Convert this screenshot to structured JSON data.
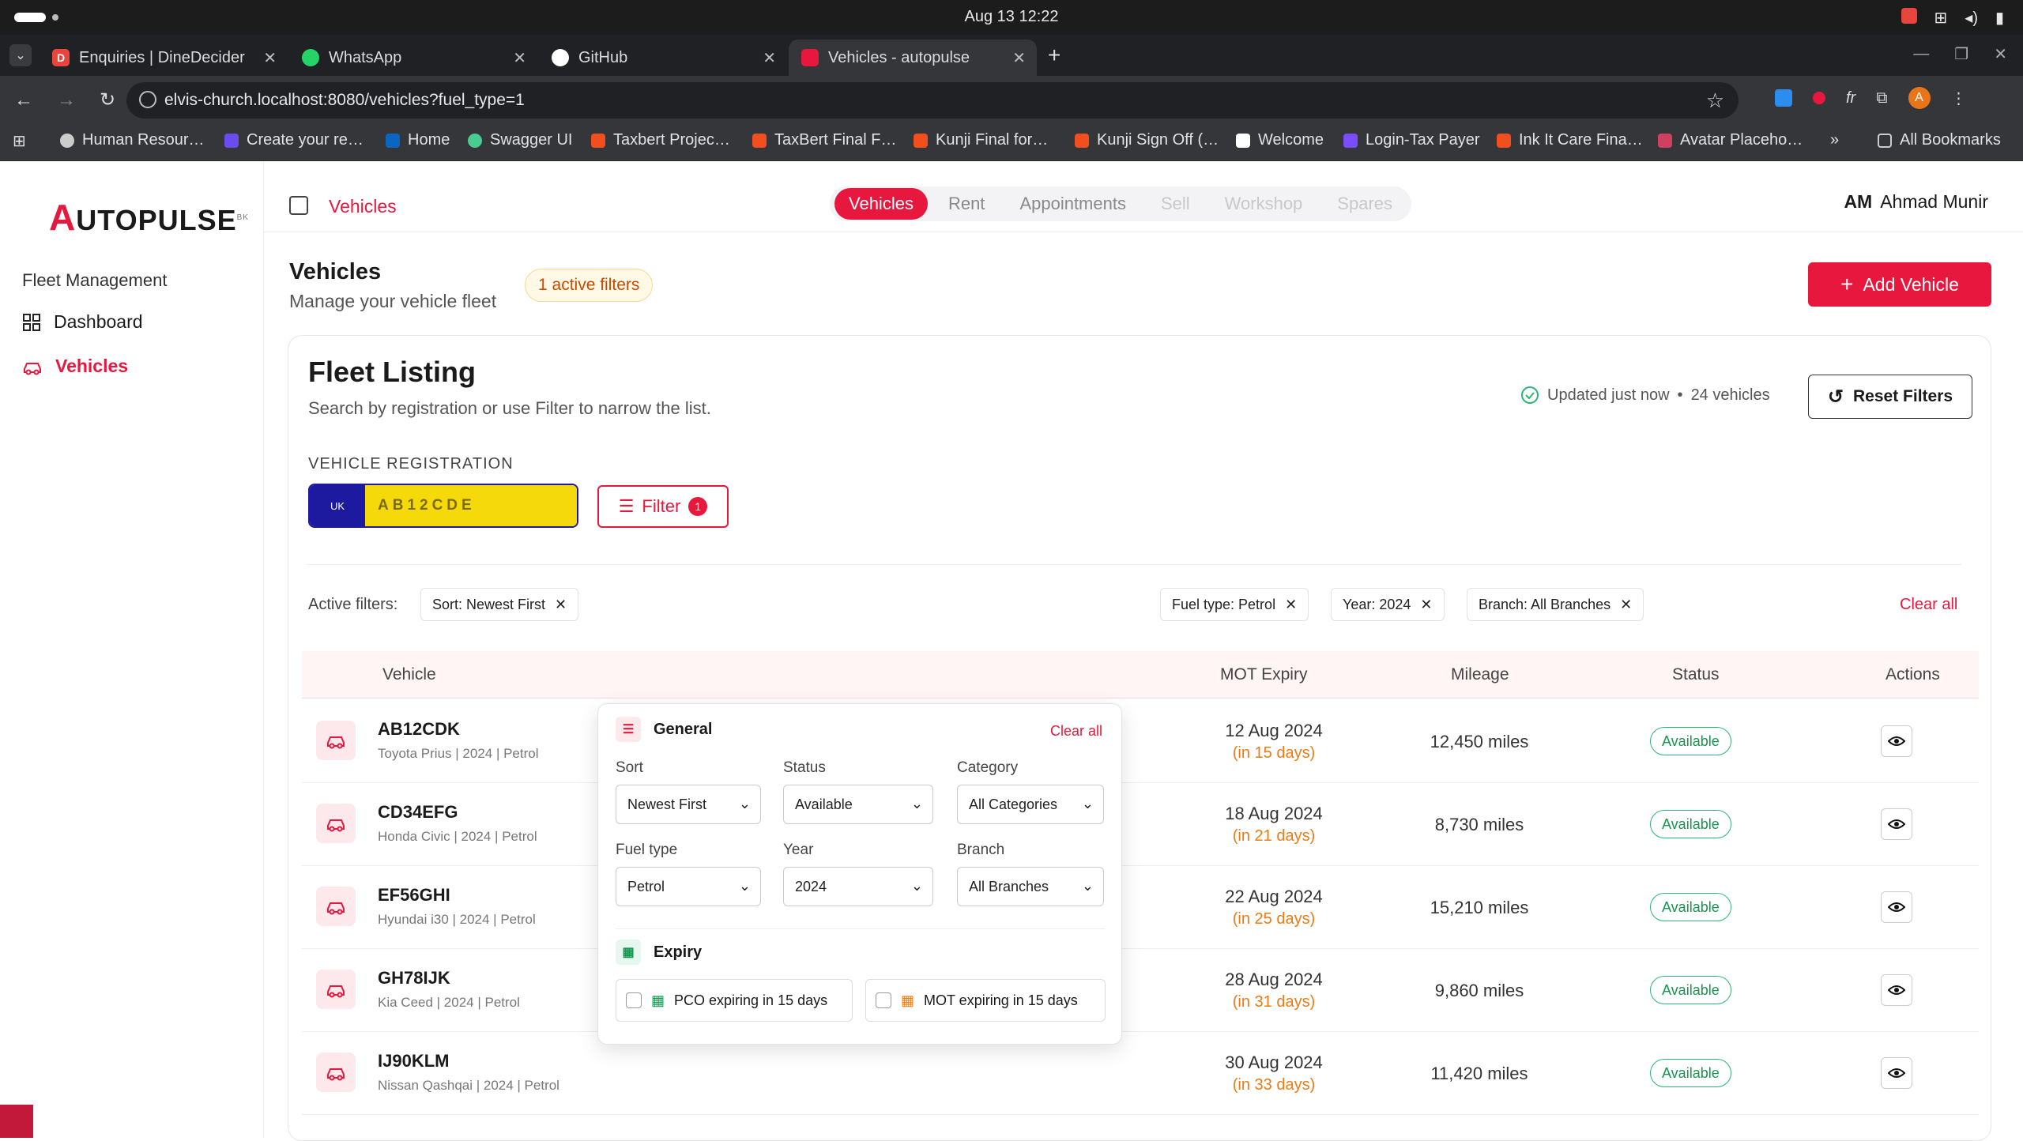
{
  "os": {
    "clock": "Aug 13  12:22"
  },
  "browser": {
    "tabs": [
      {
        "label": "Enquiries | DineDecider",
        "color": "#e8453c",
        "glyph": "D"
      },
      {
        "label": "WhatsApp",
        "color": "#25d366",
        "glyph": ""
      },
      {
        "label": "GitHub",
        "color": "#ffffff",
        "glyph": ""
      },
      {
        "label": "Vehicles - autopulse",
        "color": "#e8173d",
        "glyph": ""
      }
    ],
    "url": "elvis-church.localhost:8080/vehicles?fuel_type=1",
    "bookmarks": [
      "Human Resour…",
      "Create your re…",
      "Home",
      "Swagger UI",
      "Taxbert Projec…",
      "TaxBert Final F…",
      "Kunji Final for…",
      "Kunji Sign Off (…",
      "Welcome",
      "Login-Tax Payer",
      "Ink It Care Fina…",
      "Avatar Placeho…"
    ],
    "all_bookmarks": "All Bookmarks",
    "profile_initial": "A"
  },
  "sidebar": {
    "logo_mark": "A",
    "logo_text": "UTOPULSE",
    "logo_sup": "BK",
    "section": "Fleet Management",
    "items": [
      {
        "label": "Dashboard"
      },
      {
        "label": "Vehicles"
      }
    ]
  },
  "topnav": {
    "crumb": "Vehicles",
    "tabs": [
      "Vehicles",
      "Rent",
      "Appointments",
      "Sell",
      "Workshop",
      "Spares"
    ],
    "user_initials": "AM",
    "user_name": "Ahmad Munir"
  },
  "header": {
    "title": "Vehicles",
    "subtitle": "Manage your vehicle fleet",
    "filters_badge": "1 active filters",
    "add_button": "Add Vehicle"
  },
  "card": {
    "title": "Fleet Listing",
    "subtitle": "Search by registration or use Filter to narrow the list.",
    "updated": "Updated just now",
    "count": "24 vehicles",
    "reset": "Reset Filters",
    "reg_label": "VEHICLE REGISTRATION",
    "reg_country": "UK",
    "reg_placeholder": "AB12CDE",
    "filter_label": "Filter",
    "filter_count": "1"
  },
  "active_filters": {
    "label": "Active filters:",
    "chips": [
      "Sort: Newest First",
      "Fuel type: Petrol",
      "Year: 2024",
      "Branch: All Branches"
    ],
    "clear": "Clear all"
  },
  "table": {
    "headers": [
      "Vehicle",
      "MOT Expiry",
      "Mileage",
      "Status",
      "Actions"
    ],
    "rows": [
      {
        "reg": "AB12CDK",
        "desc": "Toyota Prius | 2024 | Petrol",
        "mot": "12 Aug 2024",
        "days": "(in 15 days)",
        "mileage": "12,450 miles",
        "status": "Available"
      },
      {
        "reg": "CD34EFG",
        "desc": "Honda Civic | 2024 | Petrol",
        "mot": "18 Aug 2024",
        "days": "(in 21 days)",
        "mileage": "8,730 miles",
        "status": "Available"
      },
      {
        "reg": "EF56GHI",
        "desc": "Hyundai i30 | 2024 | Petrol",
        "mot": "22 Aug 2024",
        "days": "(in 25 days)",
        "mileage": "15,210 miles",
        "status": "Available"
      },
      {
        "reg": "GH78IJK",
        "desc": "Kia Ceed | 2024 | Petrol",
        "mot": "28 Aug 2024",
        "days": "(in 31 days)",
        "mileage": "9,860 miles",
        "status": "Available"
      },
      {
        "reg": "IJ90KLM",
        "desc": "Nissan Qashqai | 2024 | Petrol",
        "mot": "30 Aug 2024",
        "days": "(in 33 days)",
        "mileage": "11,420 miles",
        "status": "Available"
      }
    ]
  },
  "filter_panel": {
    "general": "General",
    "clear_all": "Clear all",
    "sort_label": "Sort",
    "sort_value": "Newest First",
    "status_label": "Status",
    "status_value": "Available",
    "category_label": "Category",
    "category_value": "All Categories",
    "fuel_label": "Fuel type",
    "fuel_value": "Petrol",
    "year_label": "Year",
    "year_value": "2024",
    "branch_label": "Branch",
    "branch_value": "All Branches",
    "expiry": "Expiry",
    "pco": "PCO expiring in 15 days",
    "mot": "MOT expiring in 15 days"
  },
  "colors": {
    "accent": "#e8173d",
    "plate_yellow": "#f5d90a",
    "plate_blue": "#1d1aa0",
    "warning": "#f07a12",
    "success": "#15964f"
  }
}
